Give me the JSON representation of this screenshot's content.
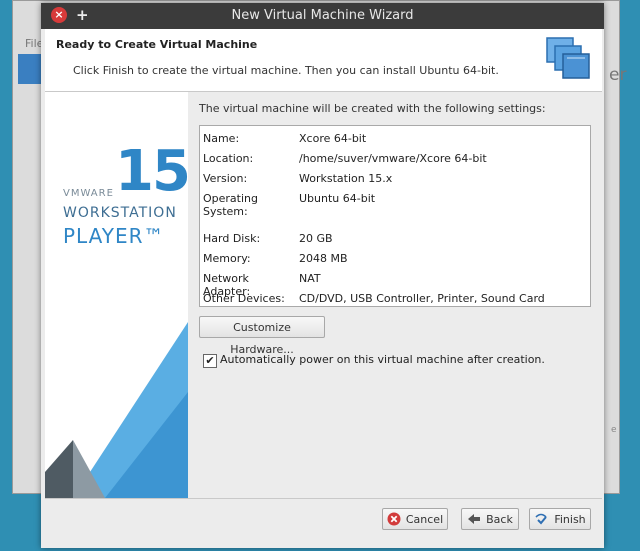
{
  "window": {
    "title": "New Virtual Machine Wizard",
    "close_glyph": "×",
    "add_glyph": "+"
  },
  "background_window": {
    "menu_label": "File",
    "right_heading_fragment": "er",
    "right_small_fragment": "e"
  },
  "header": {
    "title": "Ready to Create Virtual Machine",
    "subtitle": "Click Finish to create the virtual machine. Then you can install Ubuntu 64-bit.",
    "icon": "virtual-machine-stack-icon"
  },
  "sidebar": {
    "logo_number": "15",
    "brand": "VMWARE",
    "product_line": "WORKSTATION",
    "product_edition": "PLAYER™"
  },
  "main": {
    "intro": "The virtual machine will be created with the following settings:",
    "settings": [
      {
        "label": "Name:",
        "value": "Xcore 64-bit"
      },
      {
        "label": "Location:",
        "value": "/home/suver/vmware/Xcore 64-bit"
      },
      {
        "label": "Version:",
        "value": "Workstation 15.x"
      },
      {
        "label": "Operating System:",
        "value": "Ubuntu 64-bit"
      },
      {
        "label": "Hard Disk:",
        "value": "20 GB"
      },
      {
        "label": "Memory:",
        "value": "2048 MB"
      },
      {
        "label": "Network Adapter:",
        "value": "NAT"
      },
      {
        "label": "Other Devices:",
        "value": "CD/DVD, USB Controller, Printer, Sound Card"
      }
    ],
    "customize_label": "Customize Hardware...",
    "power_on": {
      "checked": true,
      "check_glyph": "✔",
      "label": "Automatically power on this virtual machine after creation."
    }
  },
  "footer": {
    "cancel_label": "Cancel",
    "back_label": "Back",
    "finish_label": "Finish"
  },
  "colors": {
    "desktop": "#2f8fb3",
    "titlebar": "#3b3b3b",
    "dialog": "#ececec",
    "brand_blue": "#2f86c6",
    "close_red": "#d73a3a"
  }
}
